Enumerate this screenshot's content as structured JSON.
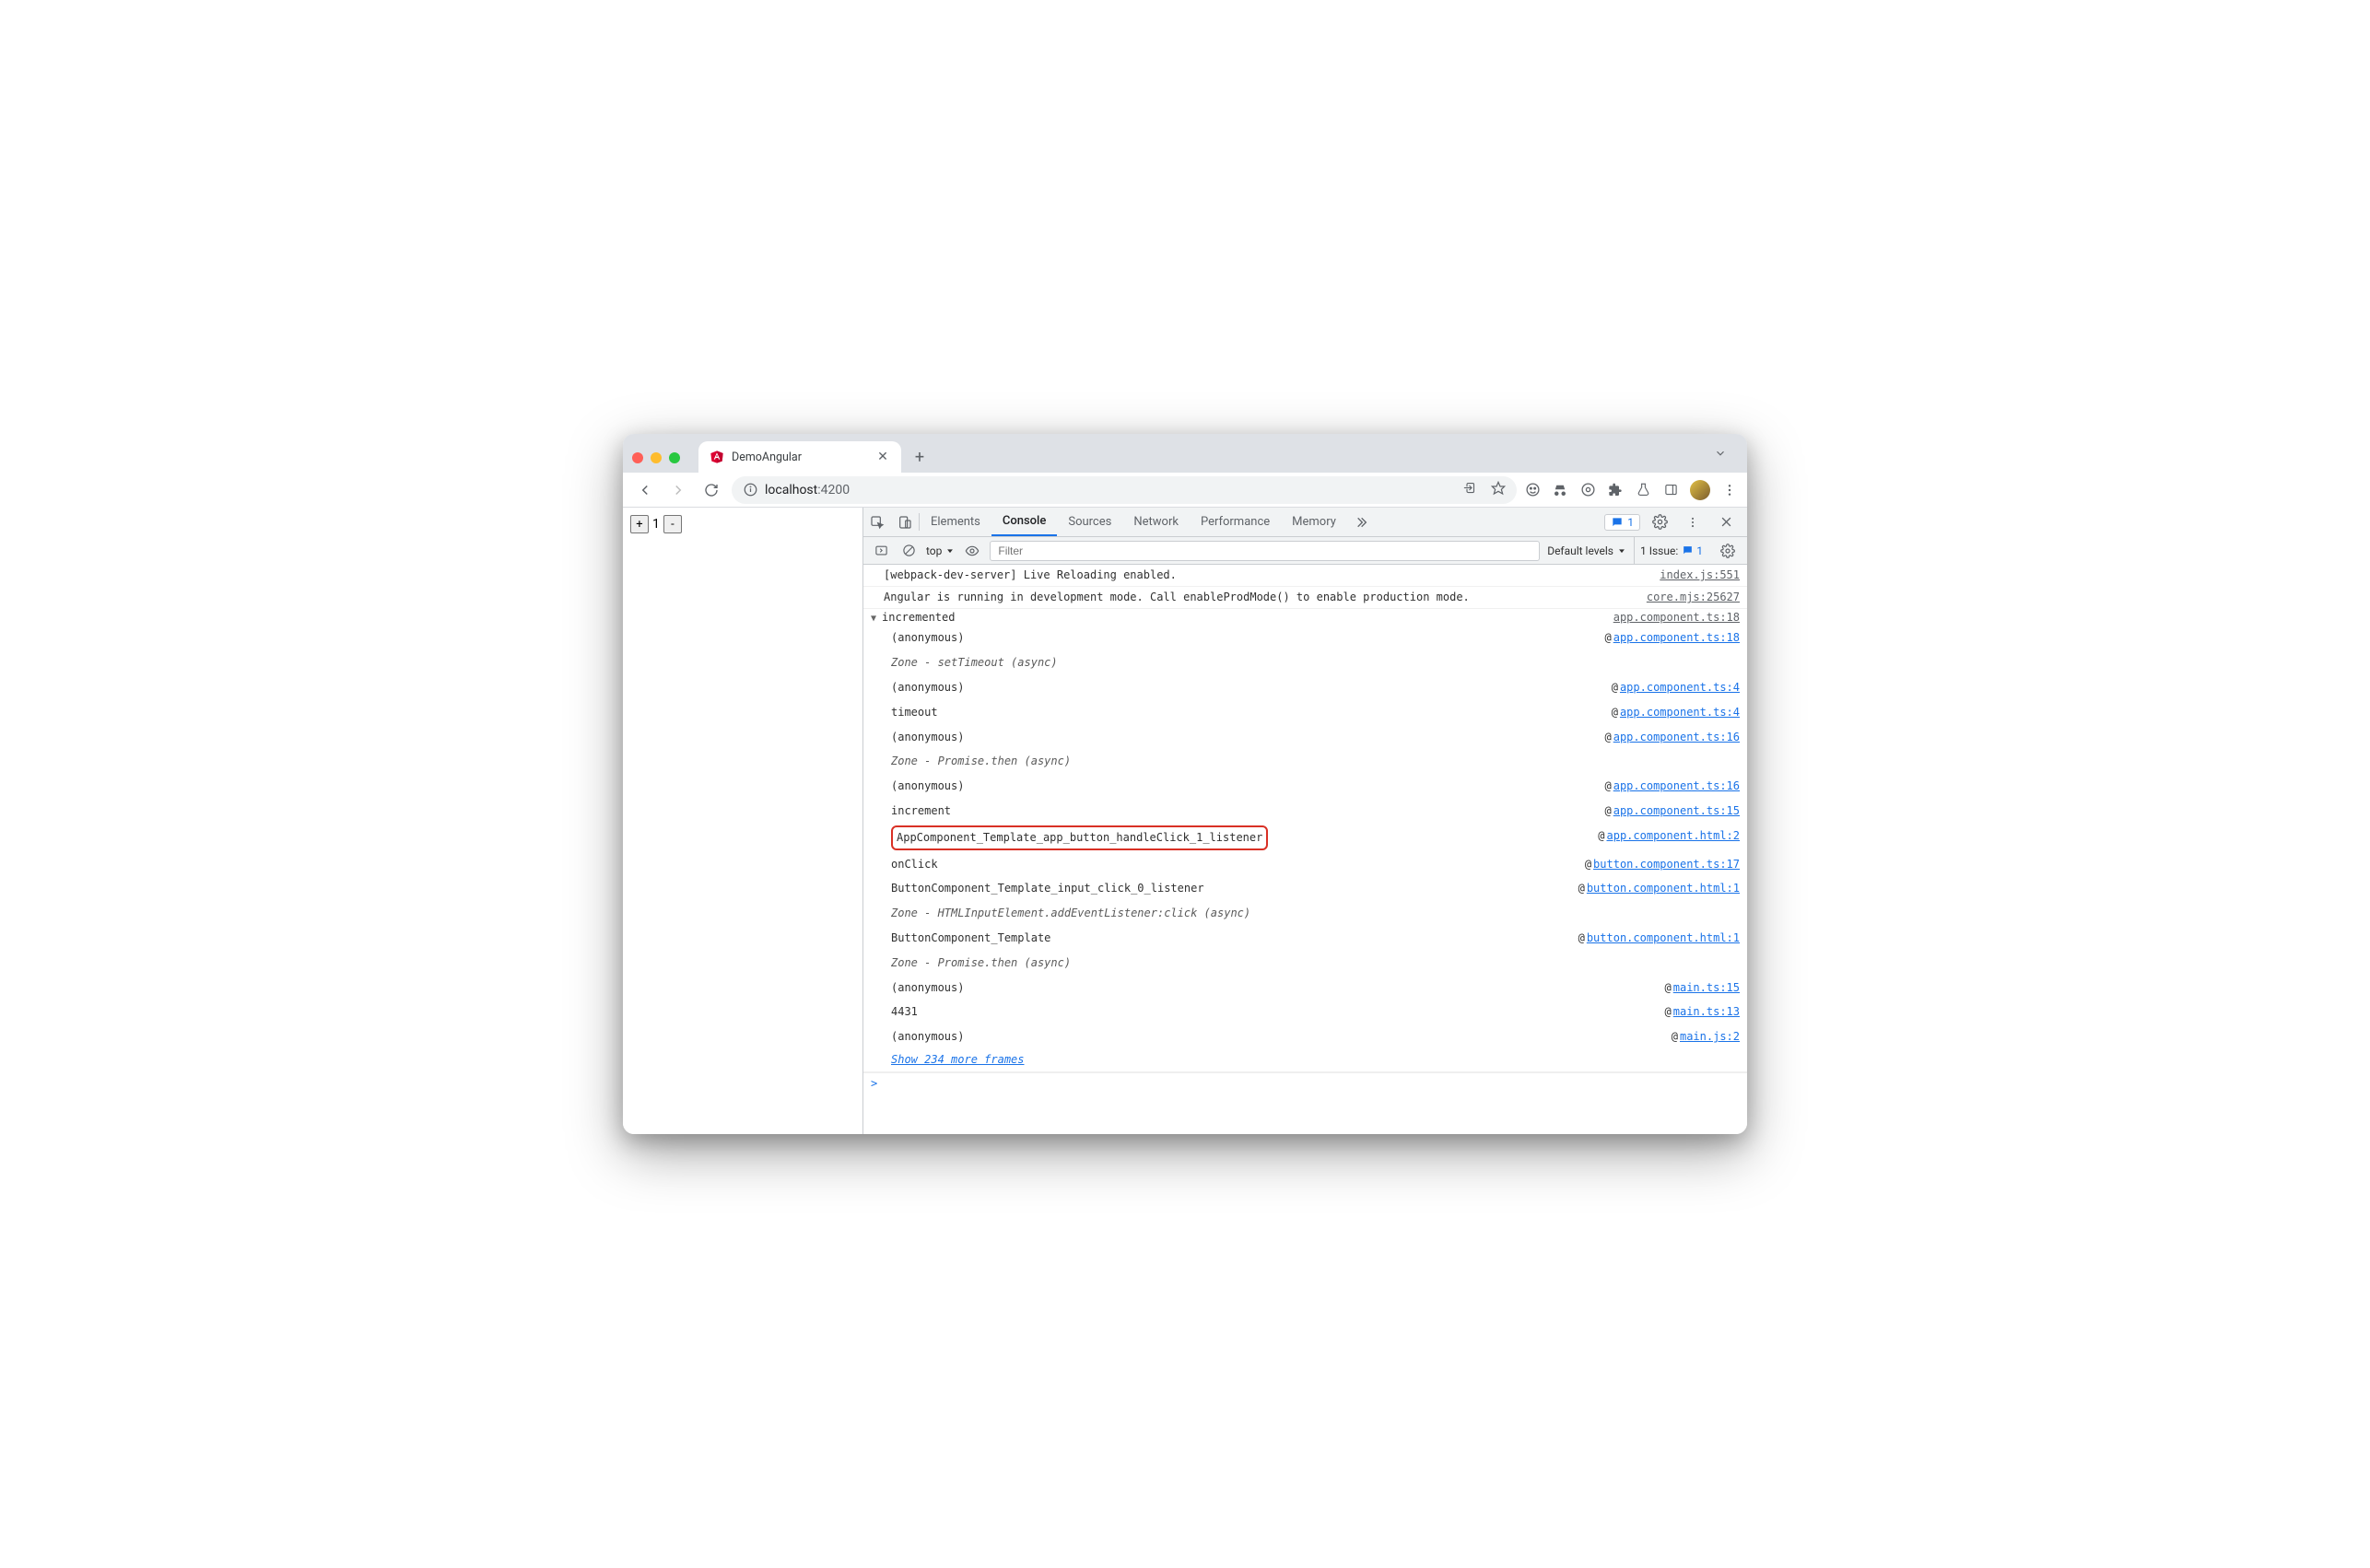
{
  "tab": {
    "title": "DemoAngular"
  },
  "url": {
    "host": "localhost",
    "port": ":4200"
  },
  "page": {
    "plus": "+",
    "value": "1",
    "minus": "-"
  },
  "devtools": {
    "tabs": {
      "elements": "Elements",
      "console": "Console",
      "sources": "Sources",
      "network": "Network",
      "performance": "Performance",
      "memory": "Memory"
    },
    "badge_count": "1",
    "sub": {
      "context": "top",
      "filter_placeholder": "Filter",
      "levels": "Default levels",
      "issues_label": "1 Issue:",
      "issues_count": "1"
    }
  },
  "log": {
    "l1": {
      "msg": "[webpack-dev-server] Live Reloading enabled.",
      "src": "index.js:551"
    },
    "l2": {
      "msg": "Angular is running in development mode. Call enableProdMode() to enable production mode.",
      "src": "core.mjs:25627"
    },
    "trace": {
      "label": "incremented",
      "src": "app.component.ts:18",
      "frames": [
        {
          "fn": "(anonymous)",
          "loc": "app.component.ts:18",
          "link": true
        },
        {
          "fn": "Zone - setTimeout (async)",
          "italic": true
        },
        {
          "fn": "(anonymous)",
          "loc": "app.component.ts:4",
          "link": true
        },
        {
          "fn": "timeout",
          "loc": "app.component.ts:4",
          "link": true
        },
        {
          "fn": "(anonymous)",
          "loc": "app.component.ts:16",
          "link": true
        },
        {
          "fn": "Zone - Promise.then (async)",
          "italic": true
        },
        {
          "fn": "(anonymous)",
          "loc": "app.component.ts:16",
          "link": true
        },
        {
          "fn": "increment",
          "loc": "app.component.ts:15",
          "link": true
        },
        {
          "fn": "AppComponent_Template_app_button_handleClick_1_listener",
          "loc": "app.component.html:2",
          "link": true,
          "hl": true
        },
        {
          "fn": "onClick",
          "loc": "button.component.ts:17",
          "link": true
        },
        {
          "fn": "ButtonComponent_Template_input_click_0_listener",
          "loc": "button.component.html:1",
          "link": true
        },
        {
          "fn": "Zone - HTMLInputElement.addEventListener:click (async)",
          "italic": true
        },
        {
          "fn": "ButtonComponent_Template",
          "loc": "button.component.html:1",
          "link": true
        },
        {
          "fn": "Zone - Promise.then (async)",
          "italic": true
        },
        {
          "fn": "(anonymous)",
          "loc": "main.ts:15",
          "link": true
        },
        {
          "fn": "4431",
          "loc": "main.ts:13",
          "link": true
        },
        {
          "fn": "(anonymous)",
          "loc": "main.js:2",
          "link": true
        }
      ],
      "more": "Show 234 more frames"
    }
  },
  "prompt": ">"
}
